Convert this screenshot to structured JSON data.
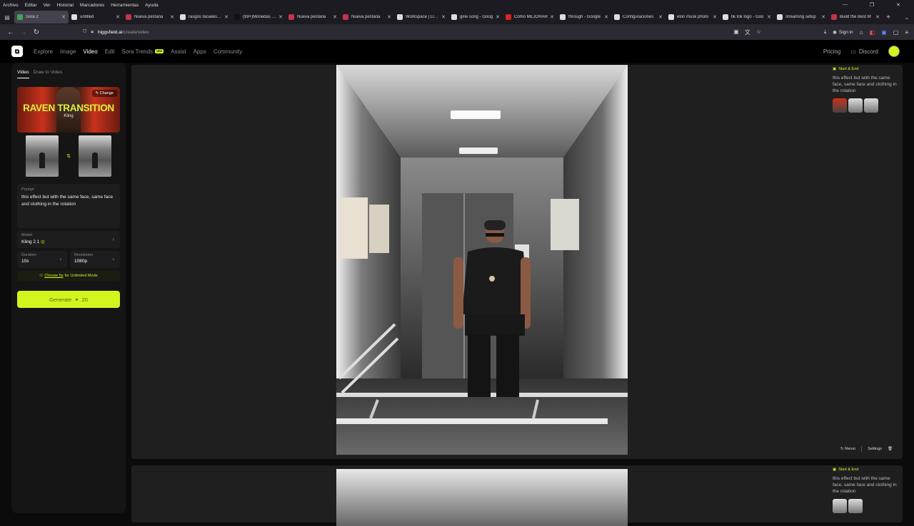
{
  "menubar": {
    "items": [
      "Archivo",
      "Editar",
      "Ver",
      "Historial",
      "Marcadores",
      "Herramientas",
      "Ayuda"
    ]
  },
  "tabs": [
    {
      "label": "Sora 2",
      "color": "#3ea55a",
      "active": true
    },
    {
      "label": "untitled",
      "color": "#e0e0e0",
      "active": false
    },
    {
      "label": "Nueva pestaña",
      "color": "#c0354b",
      "active": false
    },
    {
      "label": "rasgos faciales en",
      "color": "#dddddd",
      "active": false
    },
    {
      "label": "(99+)Monedas de",
      "color": "#111111",
      "active": false
    },
    {
      "label": "Nueva pestaña",
      "color": "#c0354b",
      "active": false
    },
    {
      "label": "Nueva pestaña",
      "color": "#c0354b",
      "active": false
    },
    {
      "label": "Workspace | LIVE",
      "color": "#dddddd",
      "active": false
    },
    {
      "label": "girei song - Goog",
      "color": "#dddddd",
      "active": false
    },
    {
      "label": "Cómo MEJORAR",
      "color": "#e02020",
      "active": false
    },
    {
      "label": "through - Google",
      "color": "#dddddd",
      "active": false
    },
    {
      "label": "Configuraciones",
      "color": "#dddddd",
      "active": false
    },
    {
      "label": "elon musk photo",
      "color": "#dddddd",
      "active": false
    },
    {
      "label": "tik tok logo - Goo",
      "color": "#dddddd",
      "active": false
    },
    {
      "label": "streaming setup",
      "color": "#dddddd",
      "active": false
    },
    {
      "label": "Build the Best M",
      "color": "#c0354b",
      "active": false
    }
  ],
  "url": {
    "host": "higgsfield.ai",
    "path": "/create/video"
  },
  "browser": {
    "signin_label": "Sign in"
  },
  "header": {
    "logo": "⧉",
    "nav": [
      {
        "label": "Explore",
        "active": false
      },
      {
        "label": "Image",
        "active": false
      },
      {
        "label": "Video",
        "active": true
      },
      {
        "label": "Edit",
        "active": false
      },
      {
        "label": "Sora Trends",
        "active": false,
        "badge": "NEW"
      },
      {
        "label": "Assist",
        "active": false
      },
      {
        "label": "Apps",
        "active": false
      },
      {
        "label": "Community",
        "active": false
      }
    ],
    "pricing": "Pricing",
    "discord": "Discord"
  },
  "leftpanel": {
    "tabs": [
      "Video",
      "Draw to Video"
    ],
    "effect": {
      "title": "RAVEN TRANSITION",
      "subtitle": "Kling",
      "change_label": "Change"
    },
    "prompt_label": "Prompt",
    "prompt_text": "this effect but with the same face, same face and clothing in the rotation",
    "model_label": "Model",
    "model_value": "Kling 2.1",
    "duration_label": "Duration",
    "duration_value": "10s",
    "resolution_label": "Resolution",
    "resolution_value": "1080p",
    "unlimited_link": "Choose 5s",
    "unlimited_rest": "for Unlimited Mode",
    "generate_label": "Generate",
    "generate_cost": "20"
  },
  "results": [
    {
      "tag": "Start & End",
      "prompt": "this effect but with the same face, same face and clothing in the rotation",
      "rerun": "Rerun",
      "settings": "Settings"
    },
    {
      "tag": "Start & End",
      "prompt": "this effect but with the same face, same face and clothing in the rotation"
    }
  ],
  "colors": {
    "accent": "#d2f51e",
    "background": "#0b0b0b",
    "panel": "#151515"
  }
}
